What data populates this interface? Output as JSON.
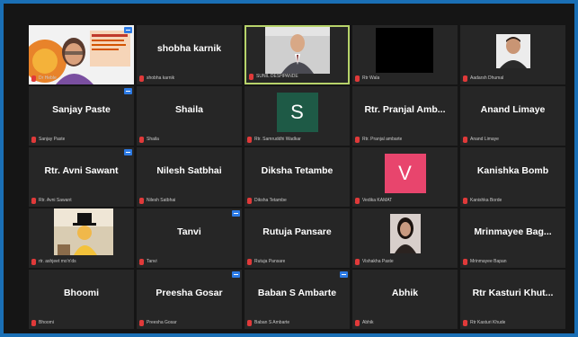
{
  "tiles": [
    {
      "footer": "Dr Heble",
      "center": "",
      "kind": "video-speaker",
      "badge": true
    },
    {
      "footer": "shobha karnik",
      "center": "shobha karnik",
      "kind": "name",
      "badge": false
    },
    {
      "footer": "SUNIL DESHPANDE",
      "center": "",
      "kind": "video-man-suit",
      "badge": false,
      "active": true
    },
    {
      "footer": "Rtr Wala",
      "center": "",
      "kind": "video-black",
      "badge": false
    },
    {
      "footer": "Aadarsh Dhumal",
      "center": "",
      "kind": "video-young-man",
      "badge": false
    },
    {
      "footer": "Sanjay Paste",
      "center": "Sanjay Paste",
      "kind": "name",
      "badge": true
    },
    {
      "footer": "Shaila",
      "center": "Shaila",
      "kind": "name",
      "badge": false
    },
    {
      "footer": "Rtr. Samruddhi Wadkar",
      "center": "",
      "kind": "avatar",
      "letter": "S",
      "avatar_color": "#1e5a46",
      "badge": false
    },
    {
      "footer": "Rtr. Pranjal ambarte",
      "center": "Rtr. Pranjal Amb...",
      "kind": "name",
      "badge": false
    },
    {
      "footer": "Anand Limaye",
      "center": "Anand Limaye",
      "kind": "name",
      "badge": false
    },
    {
      "footer": "Rtr. Avni Sawant",
      "center": "Rtr. Avni Sawant",
      "kind": "name",
      "badge": true
    },
    {
      "footer": "Nilesh Satbhai",
      "center": "Nilesh Satbhai",
      "kind": "name",
      "badge": false
    },
    {
      "footer": "Diksha Tetambe",
      "center": "Diksha Tetambe",
      "kind": "name",
      "badge": false
    },
    {
      "footer": "Vedika KAMAT",
      "center": "",
      "kind": "avatar",
      "letter": "V",
      "avatar_color": "#e8456d",
      "badge": false
    },
    {
      "footer": "Kanishka Borde",
      "center": "Kanishka Bomb",
      "kind": "name",
      "badge": false
    },
    {
      "footer": "rtr. ashjeet mo'n'ds",
      "center": "",
      "kind": "video-tophat",
      "badge": false
    },
    {
      "footer": "Tanvi",
      "center": "Tanvi",
      "kind": "name",
      "badge": true
    },
    {
      "footer": "Rutuja Pansare",
      "center": "Rutuja Pansare",
      "kind": "name",
      "badge": false
    },
    {
      "footer": "Vishakha Paste",
      "center": "",
      "kind": "video-girl",
      "badge": false
    },
    {
      "footer": "Mrinmayee Bapan",
      "center": "Mrinmayee Bag...",
      "kind": "name",
      "badge": false
    },
    {
      "footer": "Bhoomi",
      "center": "Bhoomi",
      "kind": "name",
      "badge": false
    },
    {
      "footer": "Preesha Gosar",
      "center": "Preesha Gosar",
      "kind": "name",
      "badge": true
    },
    {
      "footer": "Baban S Ambarte",
      "center": "Baban S Ambarte",
      "kind": "name",
      "badge": true
    },
    {
      "footer": "Abhik",
      "center": "Abhik",
      "kind": "name",
      "badge": false
    },
    {
      "footer": "Rtr Kasturi Khude",
      "center": "Rtr Kasturi Khut...",
      "kind": "name",
      "badge": false
    }
  ]
}
